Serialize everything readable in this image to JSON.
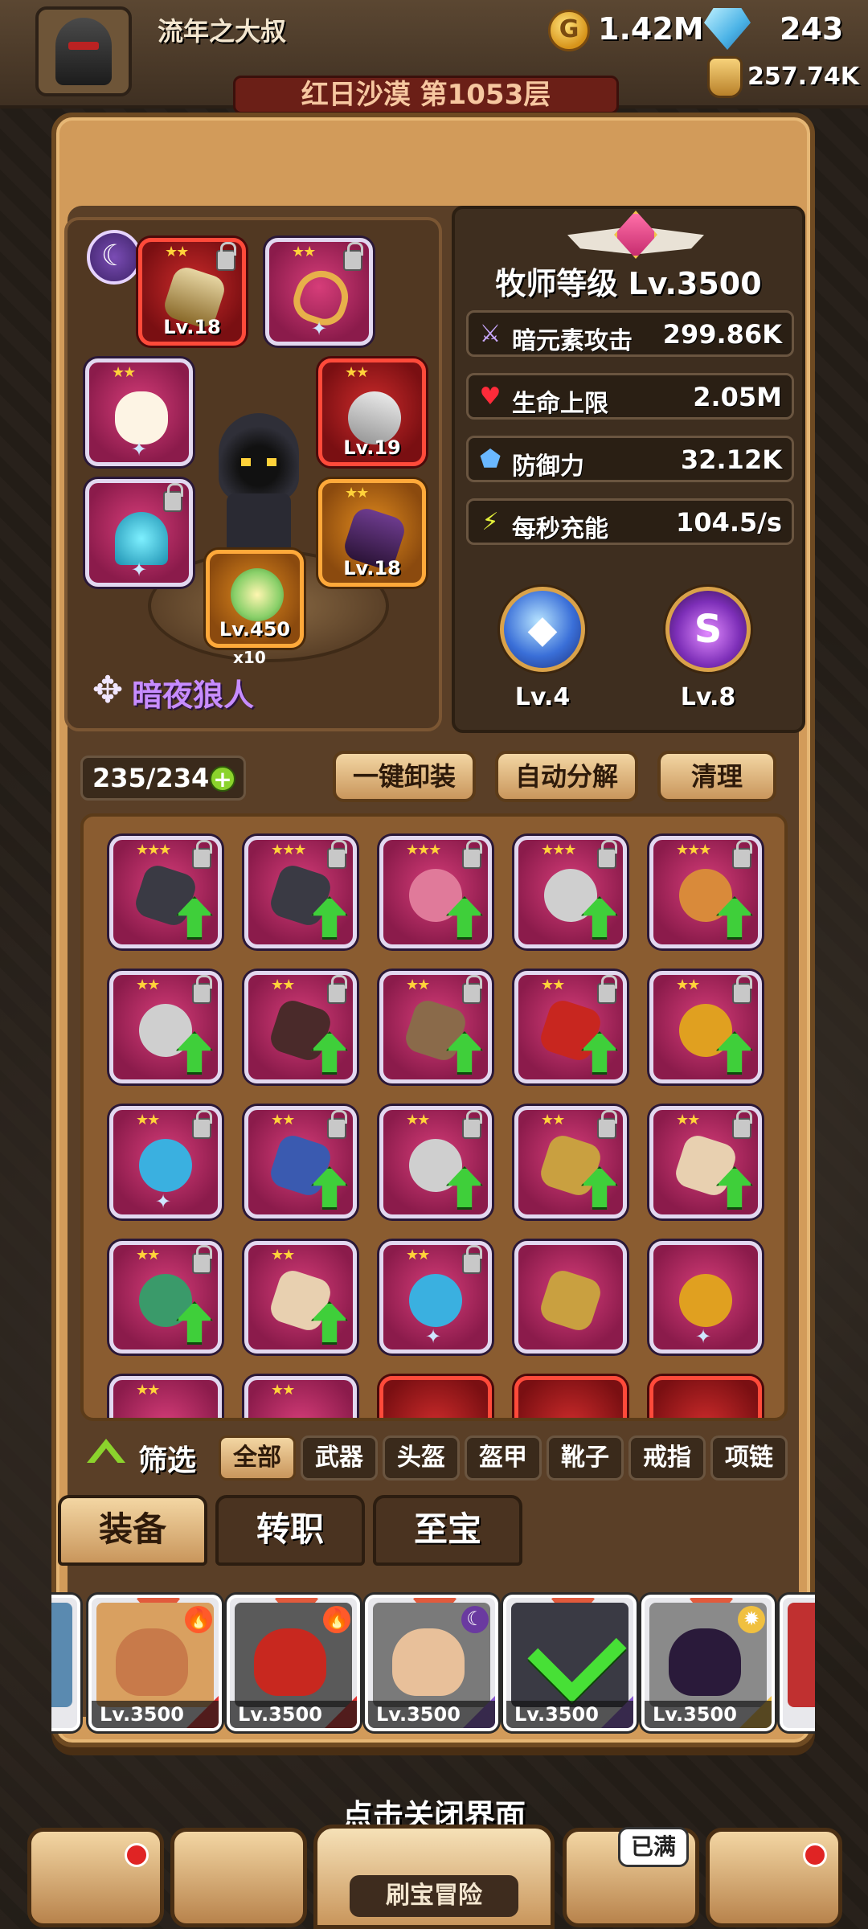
{
  "player": {
    "name": "流年之大叔"
  },
  "currency": {
    "coins": "1.42M",
    "gems": "243",
    "jar": "257.74K"
  },
  "stage": {
    "title": "红日沙漠 第1053层"
  },
  "showcase": {
    "hero_name": "暗夜狼人",
    "multiplier": "x10",
    "slots": [
      {
        "name": "weapon-slot",
        "level": "Lv.18",
        "tier": "red"
      },
      {
        "name": "necklace-slot",
        "level": "",
        "tier": "pink"
      },
      {
        "name": "helmet-slot",
        "level": "",
        "tier": "pink"
      },
      {
        "name": "ring-slot",
        "level": "Lv.19",
        "tier": "red"
      },
      {
        "name": "armor-slot",
        "level": "",
        "tier": "pink"
      },
      {
        "name": "boots-slot",
        "level": "Lv.18",
        "tier": "gold"
      },
      {
        "name": "treasure-slot",
        "level": "Lv.450",
        "tier": "gold"
      }
    ]
  },
  "stats": {
    "job_level": "牧师等级 Lv.3500",
    "rows": [
      {
        "icon": "dark-sword-icon",
        "label": "暗元素攻击",
        "value": "299.86K"
      },
      {
        "icon": "heart-icon",
        "label": "生命上限",
        "value": "2.05M"
      },
      {
        "icon": "shield-icon",
        "label": "防御力",
        "value": "32.12K"
      },
      {
        "icon": "energy-icon",
        "label": "每秒充能",
        "value": "104.5/s"
      }
    ],
    "orbs": [
      {
        "icon": "blue-shield-orb-icon",
        "level": "Lv.4"
      },
      {
        "icon": "purple-swirl-orb-icon",
        "level": "Lv.8"
      }
    ]
  },
  "inventory": {
    "capacity": "235/234",
    "actions": {
      "unequip_all": "一键卸装",
      "auto_dismantle": "自动分解",
      "cleanup": "清理"
    }
  },
  "filter": {
    "label": "筛选",
    "options": [
      "全部",
      "武器",
      "头盔",
      "盔甲",
      "靴子",
      "戒指",
      "项链"
    ],
    "selected": "全部"
  },
  "tabs": [
    "装备",
    "转职",
    "至宝"
  ],
  "heroes": [
    {
      "level": "Lv.3500",
      "element": "fire"
    },
    {
      "level": "Lv.3500",
      "element": "fire"
    },
    {
      "level": "Lv.3500",
      "element": "dark"
    },
    {
      "level": "Lv.3500",
      "element": "dark"
    },
    {
      "level": "Lv.3500",
      "element": "light"
    }
  ],
  "close_hint": "点击关闭界面",
  "bottom_nav": {
    "center_label": "刷宝冒险",
    "full_badge": "已满"
  }
}
